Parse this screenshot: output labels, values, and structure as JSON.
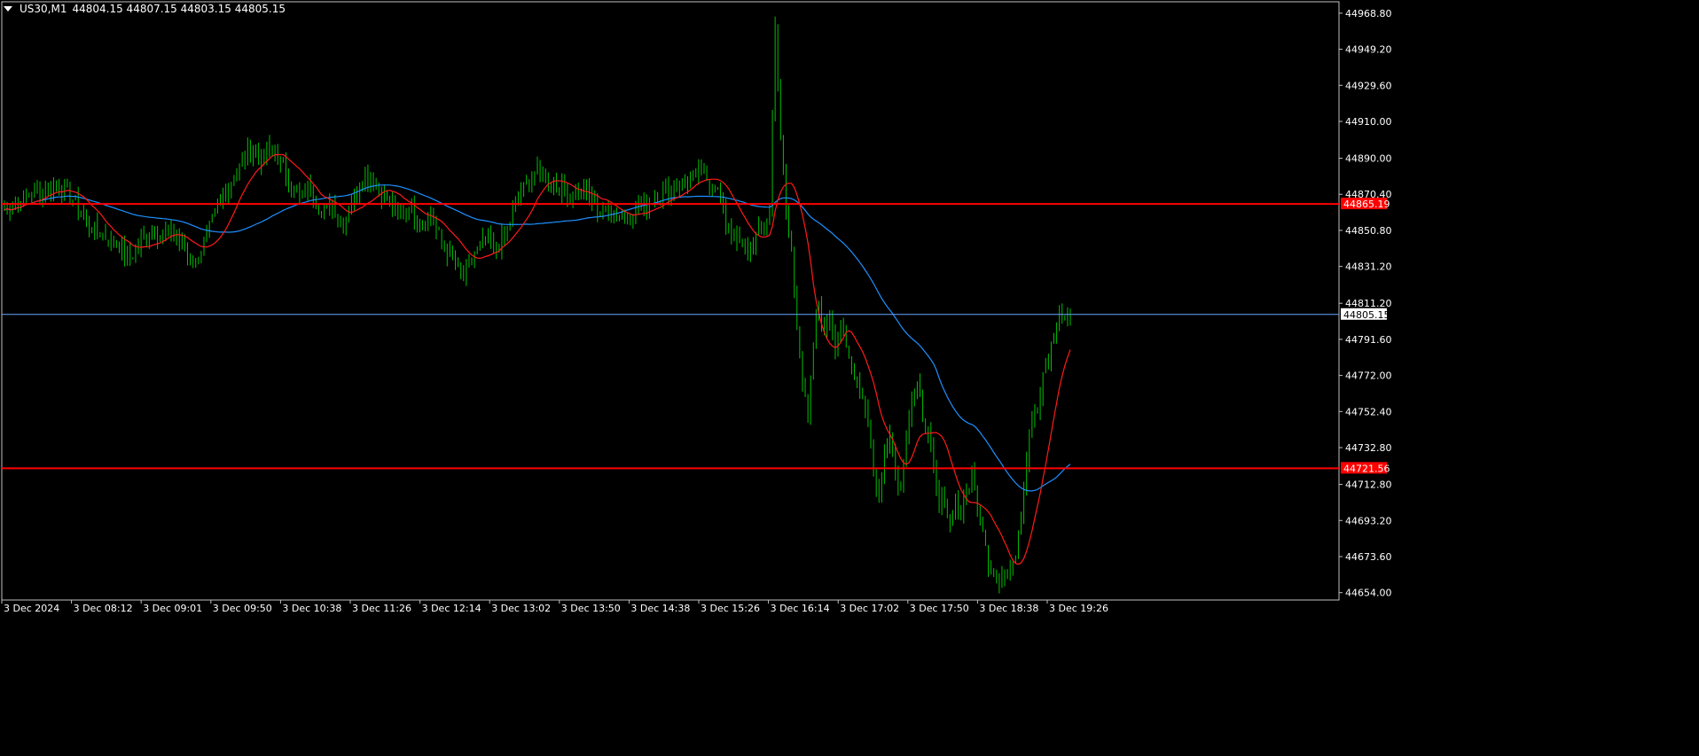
{
  "header": {
    "symbol_tf": "US30,M1",
    "ohlc": "44804.15 44807.15 44803.15 44805.15"
  },
  "colors": {
    "background": "#000000",
    "grid_frame": "#c0c0c0",
    "candle": "#00c000",
    "ma_fast": "#ff1a1a",
    "ma_slow": "#1e90ff",
    "hline_red": "#ff0000",
    "hline_bid": "#6aa6ff",
    "price_label_red_bg": "#ff0000",
    "price_label_bid_bg": "#ffffff"
  },
  "chart_data": {
    "type": "line",
    "title": "",
    "x": [
      "3 Dec 2024",
      "3 Dec 08:12",
      "3 Dec 09:01",
      "3 Dec 09:50",
      "3 Dec 10:38",
      "3 Dec 11:26",
      "3 Dec 12:14",
      "3 Dec 13:02",
      "3 Dec 13:50",
      "3 Dec 14:38",
      "3 Dec 15:26",
      "3 Dec 16:14",
      "3 Dec 17:02",
      "3 Dec 17:50",
      "3 Dec 18:38",
      "3 Dec 19:26"
    ],
    "y_ticks": [
      "44968.80",
      "44949.20",
      "44929.60",
      "44910.00",
      "44890.00",
      "44870.40",
      "44850.80",
      "44831.20",
      "44811.20",
      "44791.60",
      "44772.00",
      "44752.40",
      "44732.80",
      "44712.80",
      "44693.20",
      "44673.60",
      "44654.00"
    ],
    "ylim": [
      44650,
      44975
    ],
    "price_path": [
      [
        0,
        44862
      ],
      [
        3,
        44867
      ],
      [
        6,
        44872
      ],
      [
        9,
        44875
      ],
      [
        12,
        44870
      ],
      [
        15,
        44855
      ],
      [
        18,
        44848
      ],
      [
        21,
        44842
      ],
      [
        23,
        44836
      ],
      [
        25,
        44845
      ],
      [
        27,
        44852
      ],
      [
        29,
        44848
      ],
      [
        31,
        44850
      ],
      [
        33,
        44840
      ],
      [
        35,
        44833
      ],
      [
        37,
        44848
      ],
      [
        40,
        44870
      ],
      [
        43,
        44885
      ],
      [
        45,
        44895
      ],
      [
        47,
        44890
      ],
      [
        49,
        44895
      ],
      [
        51,
        44885
      ],
      [
        52,
        44878
      ],
      [
        54,
        44868
      ],
      [
        56,
        44875
      ],
      [
        58,
        44860
      ],
      [
        60,
        44865
      ],
      [
        62,
        44855
      ],
      [
        64,
        44870
      ],
      [
        66,
        44880
      ],
      [
        68,
        44875
      ],
      [
        70,
        44868
      ],
      [
        72,
        44860
      ],
      [
        74,
        44864
      ],
      [
        76,
        44856
      ],
      [
        78,
        44858
      ],
      [
        80,
        44845
      ],
      [
        82,
        44835
      ],
      [
        84,
        44825
      ],
      [
        86,
        44838
      ],
      [
        88,
        44845
      ],
      [
        90,
        44840
      ],
      [
        92,
        44850
      ],
      [
        94,
        44870
      ],
      [
        97,
        44882
      ],
      [
        100,
        44878
      ],
      [
        103,
        44870
      ],
      [
        106,
        44872
      ],
      [
        109,
        44862
      ],
      [
        112,
        44858
      ],
      [
        115,
        44862
      ],
      [
        118,
        44866
      ],
      [
        121,
        44872
      ],
      [
        124,
        44876
      ],
      [
        127,
        44882
      ],
      [
        130,
        44876
      ],
      [
        132,
        44856
      ],
      [
        134,
        44845
      ],
      [
        136,
        44840
      ],
      [
        138,
        44850
      ],
      [
        140,
        44860
      ],
      [
        141,
        44965
      ],
      [
        142,
        44900
      ],
      [
        143,
        44860
      ],
      [
        144,
        44840
      ],
      [
        145,
        44800
      ],
      [
        146,
        44770
      ],
      [
        147,
        44745
      ],
      [
        148,
        44790
      ],
      [
        149,
        44810
      ],
      [
        150,
        44795
      ],
      [
        151,
        44808
      ],
      [
        152,
        44790
      ],
      [
        153,
        44800
      ],
      [
        154,
        44785
      ],
      [
        156,
        44770
      ],
      [
        158,
        44750
      ],
      [
        159,
        44720
      ],
      [
        160,
        44705
      ],
      [
        161,
        44730
      ],
      [
        162,
        44745
      ],
      [
        163,
        44720
      ],
      [
        164,
        44712
      ],
      [
        165,
        44740
      ],
      [
        166,
        44760
      ],
      [
        167,
        44765
      ],
      [
        168,
        44750
      ],
      [
        169,
        44740
      ],
      [
        170,
        44720
      ],
      [
        171,
        44700
      ],
      [
        172,
        44705
      ],
      [
        173,
        44690
      ],
      [
        174,
        44705
      ],
      [
        175,
        44695
      ],
      [
        176,
        44708
      ],
      [
        177,
        44718
      ],
      [
        178,
        44700
      ],
      [
        179,
        44690
      ],
      [
        180,
        44672
      ],
      [
        181,
        44664
      ],
      [
        182,
        44657
      ],
      [
        183,
        44665
      ],
      [
        184,
        44670
      ],
      [
        185,
        44676
      ],
      [
        186,
        44700
      ],
      [
        187,
        44728
      ],
      [
        188,
        44750
      ],
      [
        189,
        44752
      ],
      [
        190,
        44770
      ],
      [
        191,
        44780
      ],
      [
        192,
        44795
      ],
      [
        193,
        44808
      ],
      [
        194,
        44802
      ],
      [
        195,
        44806
      ]
    ],
    "series": [
      {
        "name": "",
        "type": "candles"
      },
      {
        "name": "",
        "type": "ma-fast"
      },
      {
        "name": "",
        "type": "ma-slow"
      }
    ],
    "horizontal_lines": [
      {
        "price": 44865.19,
        "label": "44865.19",
        "kind": "red"
      },
      {
        "price": 44721.56,
        "label": "44721.56",
        "kind": "red"
      },
      {
        "price": 44805.15,
        "label": "44805.15",
        "kind": "bid"
      }
    ]
  }
}
